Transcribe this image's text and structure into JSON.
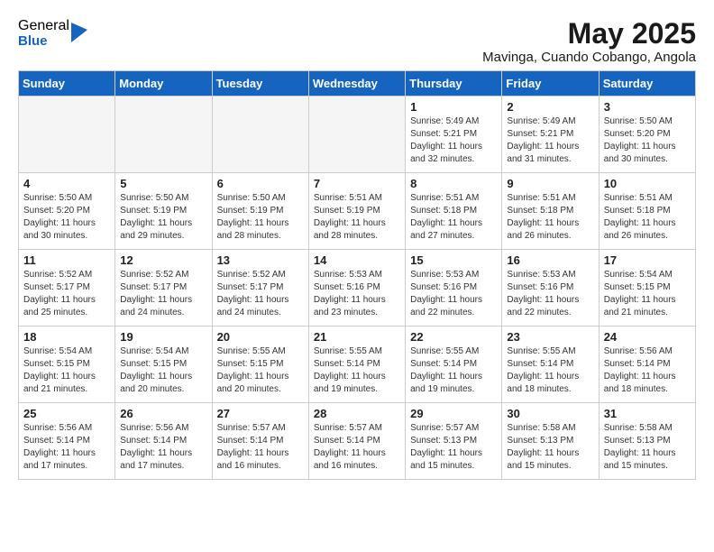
{
  "logo": {
    "general": "General",
    "blue": "Blue"
  },
  "header": {
    "month": "May 2025",
    "location": "Mavinga, Cuando Cobango, Angola"
  },
  "weekdays": [
    "Sunday",
    "Monday",
    "Tuesday",
    "Wednesday",
    "Thursday",
    "Friday",
    "Saturday"
  ],
  "weeks": [
    [
      {
        "day": "",
        "info": ""
      },
      {
        "day": "",
        "info": ""
      },
      {
        "day": "",
        "info": ""
      },
      {
        "day": "",
        "info": ""
      },
      {
        "day": "1",
        "info": "Sunrise: 5:49 AM\nSunset: 5:21 PM\nDaylight: 11 hours\nand 32 minutes."
      },
      {
        "day": "2",
        "info": "Sunrise: 5:49 AM\nSunset: 5:21 PM\nDaylight: 11 hours\nand 31 minutes."
      },
      {
        "day": "3",
        "info": "Sunrise: 5:50 AM\nSunset: 5:20 PM\nDaylight: 11 hours\nand 30 minutes."
      }
    ],
    [
      {
        "day": "4",
        "info": "Sunrise: 5:50 AM\nSunset: 5:20 PM\nDaylight: 11 hours\nand 30 minutes."
      },
      {
        "day": "5",
        "info": "Sunrise: 5:50 AM\nSunset: 5:19 PM\nDaylight: 11 hours\nand 29 minutes."
      },
      {
        "day": "6",
        "info": "Sunrise: 5:50 AM\nSunset: 5:19 PM\nDaylight: 11 hours\nand 28 minutes."
      },
      {
        "day": "7",
        "info": "Sunrise: 5:51 AM\nSunset: 5:19 PM\nDaylight: 11 hours\nand 28 minutes."
      },
      {
        "day": "8",
        "info": "Sunrise: 5:51 AM\nSunset: 5:18 PM\nDaylight: 11 hours\nand 27 minutes."
      },
      {
        "day": "9",
        "info": "Sunrise: 5:51 AM\nSunset: 5:18 PM\nDaylight: 11 hours\nand 26 minutes."
      },
      {
        "day": "10",
        "info": "Sunrise: 5:51 AM\nSunset: 5:18 PM\nDaylight: 11 hours\nand 26 minutes."
      }
    ],
    [
      {
        "day": "11",
        "info": "Sunrise: 5:52 AM\nSunset: 5:17 PM\nDaylight: 11 hours\nand 25 minutes."
      },
      {
        "day": "12",
        "info": "Sunrise: 5:52 AM\nSunset: 5:17 PM\nDaylight: 11 hours\nand 24 minutes."
      },
      {
        "day": "13",
        "info": "Sunrise: 5:52 AM\nSunset: 5:17 PM\nDaylight: 11 hours\nand 24 minutes."
      },
      {
        "day": "14",
        "info": "Sunrise: 5:53 AM\nSunset: 5:16 PM\nDaylight: 11 hours\nand 23 minutes."
      },
      {
        "day": "15",
        "info": "Sunrise: 5:53 AM\nSunset: 5:16 PM\nDaylight: 11 hours\nand 22 minutes."
      },
      {
        "day": "16",
        "info": "Sunrise: 5:53 AM\nSunset: 5:16 PM\nDaylight: 11 hours\nand 22 minutes."
      },
      {
        "day": "17",
        "info": "Sunrise: 5:54 AM\nSunset: 5:15 PM\nDaylight: 11 hours\nand 21 minutes."
      }
    ],
    [
      {
        "day": "18",
        "info": "Sunrise: 5:54 AM\nSunset: 5:15 PM\nDaylight: 11 hours\nand 21 minutes."
      },
      {
        "day": "19",
        "info": "Sunrise: 5:54 AM\nSunset: 5:15 PM\nDaylight: 11 hours\nand 20 minutes."
      },
      {
        "day": "20",
        "info": "Sunrise: 5:55 AM\nSunset: 5:15 PM\nDaylight: 11 hours\nand 20 minutes."
      },
      {
        "day": "21",
        "info": "Sunrise: 5:55 AM\nSunset: 5:14 PM\nDaylight: 11 hours\nand 19 minutes."
      },
      {
        "day": "22",
        "info": "Sunrise: 5:55 AM\nSunset: 5:14 PM\nDaylight: 11 hours\nand 19 minutes."
      },
      {
        "day": "23",
        "info": "Sunrise: 5:55 AM\nSunset: 5:14 PM\nDaylight: 11 hours\nand 18 minutes."
      },
      {
        "day": "24",
        "info": "Sunrise: 5:56 AM\nSunset: 5:14 PM\nDaylight: 11 hours\nand 18 minutes."
      }
    ],
    [
      {
        "day": "25",
        "info": "Sunrise: 5:56 AM\nSunset: 5:14 PM\nDaylight: 11 hours\nand 17 minutes."
      },
      {
        "day": "26",
        "info": "Sunrise: 5:56 AM\nSunset: 5:14 PM\nDaylight: 11 hours\nand 17 minutes."
      },
      {
        "day": "27",
        "info": "Sunrise: 5:57 AM\nSunset: 5:14 PM\nDaylight: 11 hours\nand 16 minutes."
      },
      {
        "day": "28",
        "info": "Sunrise: 5:57 AM\nSunset: 5:14 PM\nDaylight: 11 hours\nand 16 minutes."
      },
      {
        "day": "29",
        "info": "Sunrise: 5:57 AM\nSunset: 5:13 PM\nDaylight: 11 hours\nand 15 minutes."
      },
      {
        "day": "30",
        "info": "Sunrise: 5:58 AM\nSunset: 5:13 PM\nDaylight: 11 hours\nand 15 minutes."
      },
      {
        "day": "31",
        "info": "Sunrise: 5:58 AM\nSunset: 5:13 PM\nDaylight: 11 hours\nand 15 minutes."
      }
    ]
  ]
}
